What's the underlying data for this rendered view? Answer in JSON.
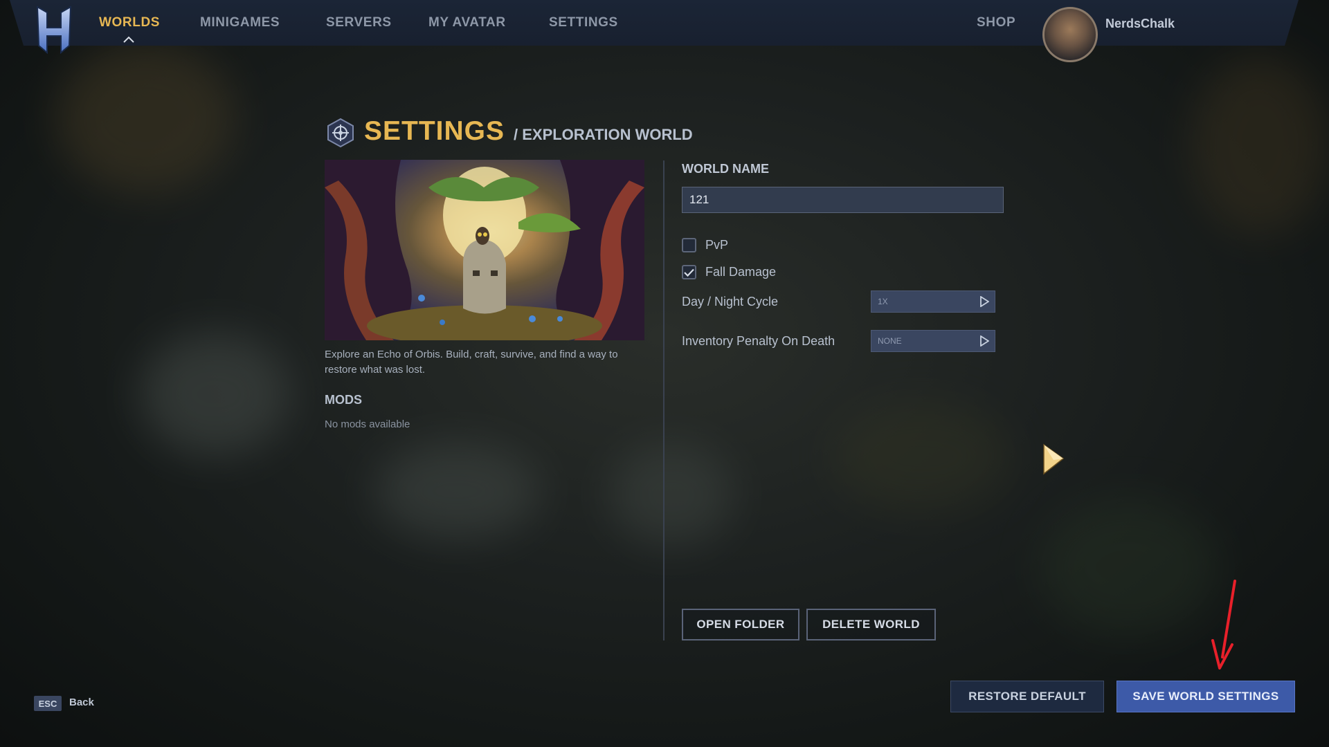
{
  "nav": {
    "items": [
      {
        "label": "WORLDS",
        "active": true
      },
      {
        "label": "MINIGAMES",
        "active": false
      },
      {
        "label": "SERVERS",
        "active": false
      },
      {
        "label": "MY AVATAR",
        "active": false
      },
      {
        "label": "SETTINGS",
        "active": false
      }
    ],
    "shop_label": "SHOP",
    "username": "NerdsChalk"
  },
  "header": {
    "title": "SETTINGS",
    "subtitle": "/ EXPLORATION WORLD"
  },
  "world": {
    "description": "Explore an Echo of Orbis. Build, craft, survive, and find a way to restore what was lost.",
    "mods_title": "MODS",
    "mods_empty": "No mods available"
  },
  "form": {
    "world_name_label": "WORLD NAME",
    "world_name_value": "121",
    "pvp_label": "PvP",
    "pvp_checked": false,
    "fall_damage_label": "Fall Damage",
    "fall_damage_checked": true,
    "day_night_label": "Day / Night Cycle",
    "day_night_value": "1X",
    "inventory_penalty_label": "Inventory Penalty On Death",
    "inventory_penalty_value": "NONE"
  },
  "buttons": {
    "open_folder": "OPEN FOLDER",
    "delete_world": "DELETE WORLD",
    "restore_default": "RESTORE DEFAULT",
    "save_world_settings": "SAVE WORLD SETTINGS"
  },
  "footer": {
    "esc_key": "ESC",
    "back_label": "Back"
  },
  "colors": {
    "accent_gold": "#e7b753",
    "primary_blue": "#3d5aa8",
    "annotation_red": "#e8202a"
  }
}
